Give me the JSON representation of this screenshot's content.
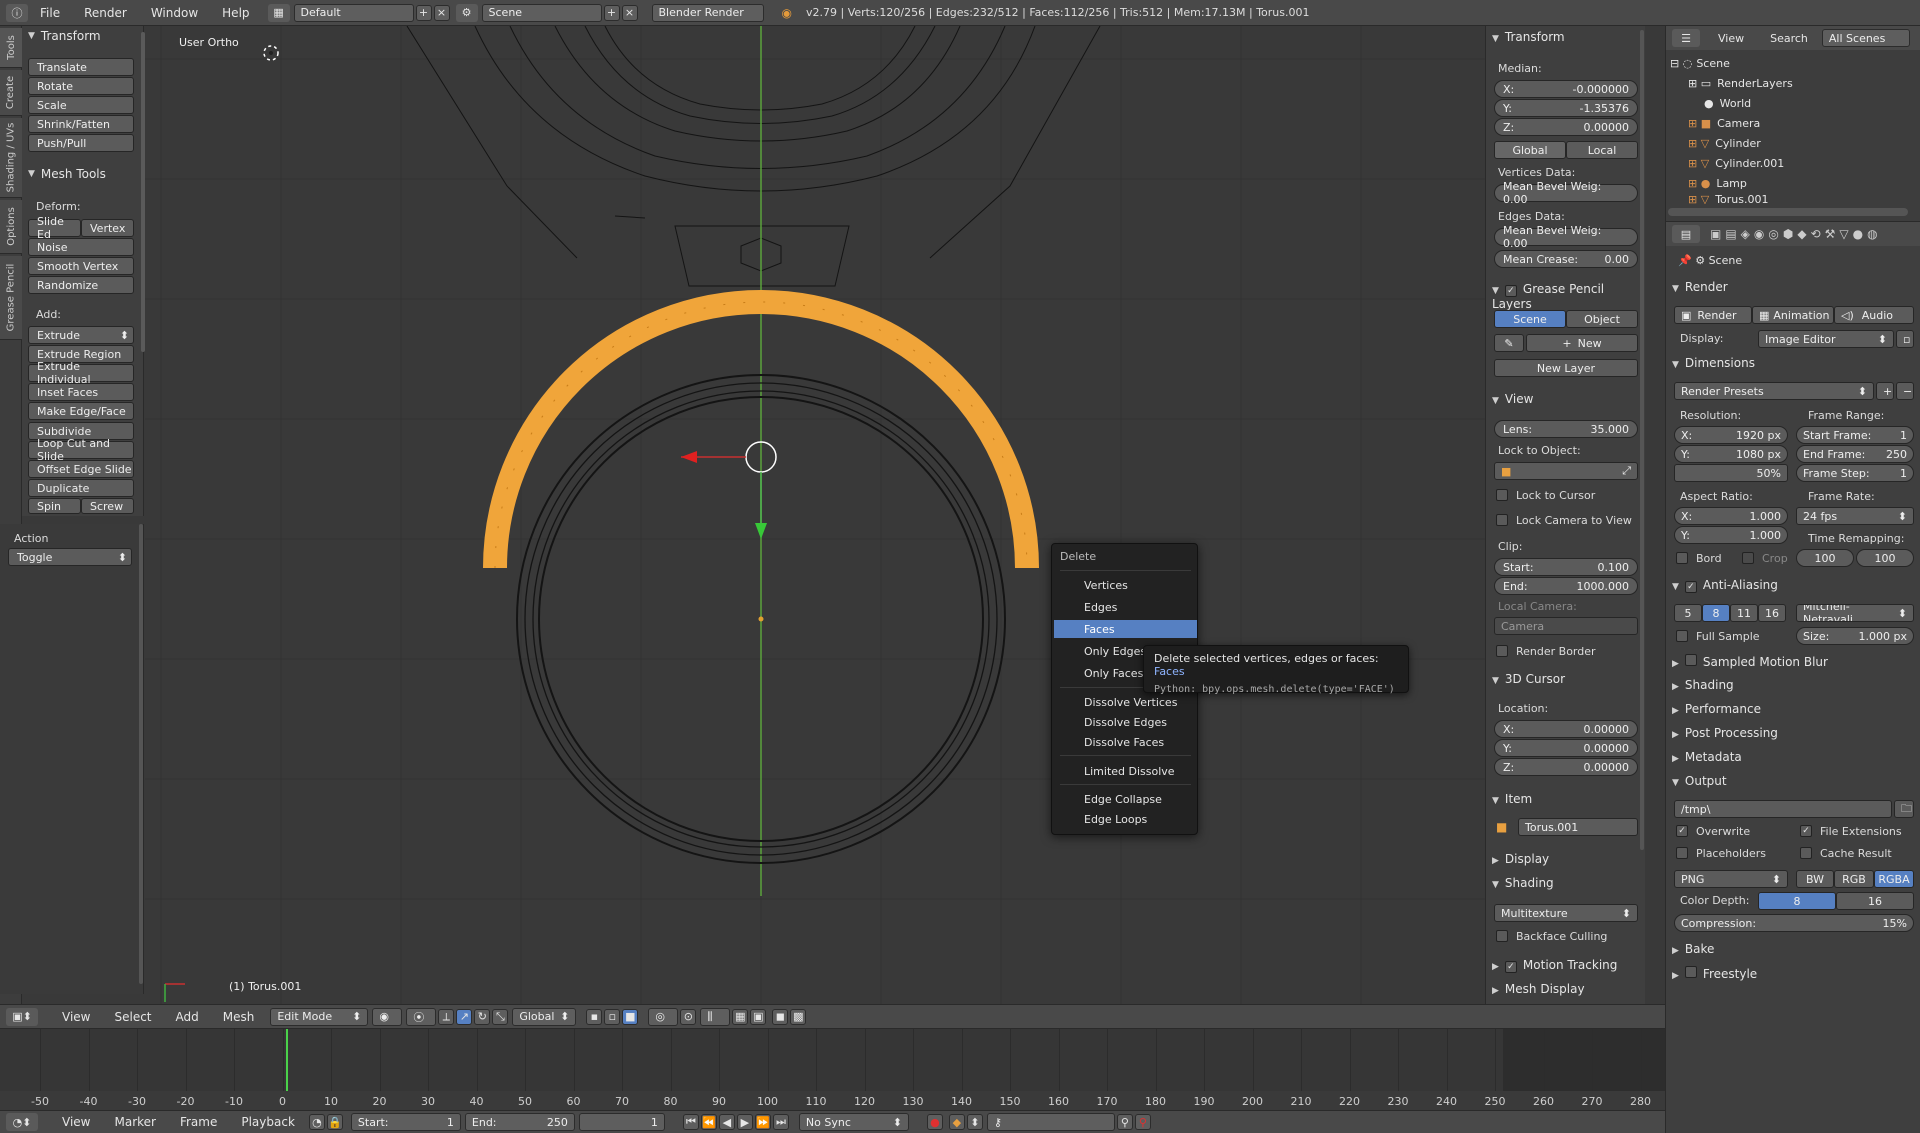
{
  "topbar": {
    "menus": [
      "File",
      "Render",
      "Window",
      "Help"
    ],
    "layout": "Default",
    "scene": "Scene",
    "engine": "Blender Render",
    "status": "v2.79 | Verts:120/256 | Edges:232/512 | Faces:112/256 | Tris:512 | Mem:17.13M | Torus.001"
  },
  "left_tabs": [
    "Tools",
    "Create",
    "Shading / UVs",
    "Options",
    "Grease Pencil"
  ],
  "tools": {
    "transform_title": "Transform",
    "transform": [
      "Translate",
      "Rotate",
      "Scale",
      "Shrink/Fatten",
      "Push/Pull"
    ],
    "mesh_tools_title": "Mesh Tools",
    "deform_label": "Deform:",
    "slide_edge": "Slide Ed",
    "vertex": "Vertex",
    "deform": [
      "Noise",
      "Smooth Vertex",
      "Randomize"
    ],
    "add_label": "Add:",
    "extrude": "Extrude",
    "add": [
      "Extrude Region",
      "Extrude Individual",
      "Inset Faces",
      "Make Edge/Face",
      "Subdivide",
      "Loop Cut and Slide",
      "Offset Edge Slide",
      "Duplicate"
    ],
    "spin": "Spin",
    "screw": "Screw"
  },
  "action": {
    "label": "Action",
    "value": "Toggle"
  },
  "viewport": {
    "view_label": "User Ortho",
    "object_label": "(1) Torus.001"
  },
  "delete_menu": {
    "title": "Delete",
    "items": [
      "Vertices",
      "Edges",
      "Faces",
      "Only Edges & Faces",
      "Only Faces",
      "Dissolve Vertices",
      "Dissolve Edges",
      "Dissolve Faces",
      "Limited Dissolve",
      "Edge Collapse",
      "Edge Loops"
    ],
    "selected": "Faces"
  },
  "tooltip": {
    "text": "Delete selected vertices, edges or faces:",
    "value": "Faces",
    "python": "Python: bpy.ops.mesh.delete(type='FACE')"
  },
  "npanel": {
    "transform_title": "Transform",
    "median": "Median:",
    "x": "X:",
    "x_val": "-0.000000",
    "y": "Y:",
    "y_val": "-1.35376",
    "z": "Z:",
    "z_val": "0.00000",
    "global": "Global",
    "local": "Local",
    "vertices_data": "Vertices Data:",
    "mean_bevel_v": "Mean Bevel Weig: 0.00",
    "edges_data": "Edges Data:",
    "mean_bevel_e": "Mean Bevel Weig: 0.00",
    "mean_crease": "Mean Crease:",
    "mean_crease_val": "0.00",
    "gp_title": "Grease Pencil Layers",
    "scene_btn": "Scene",
    "object_btn": "Object",
    "new": "New",
    "new_layer": "New Layer",
    "view_title": "View",
    "lens": "Lens:",
    "lens_val": "35.000",
    "lock_to_object": "Lock to Object:",
    "lock_to_cursor": "Lock to Cursor",
    "lock_camera": "Lock Camera to View",
    "clip": "Clip:",
    "clip_start": "Start:",
    "clip_start_val": "0.100",
    "clip_end": "End:",
    "clip_end_val": "1000.000",
    "local_camera": "Local Camera:",
    "camera": "Camera",
    "render_border": "Render Border",
    "cursor_title": "3D Cursor",
    "location": "Location:",
    "cx": "X:",
    "cx_val": "0.00000",
    "cy": "Y:",
    "cy_val": "0.00000",
    "cz": "Z:",
    "cz_val": "0.00000",
    "item_title": "Item",
    "item_name": "Torus.001",
    "display_title": "Display",
    "shading_title": "Shading",
    "multitexture": "Multitexture",
    "backface": "Backface Culling",
    "motion_tracking": "Motion Tracking",
    "mesh_display": "Mesh Display"
  },
  "outliner": {
    "view": "View",
    "search": "Search",
    "all_scenes": "All Scenes",
    "items": [
      "Scene",
      "RenderLayers",
      "World",
      "Camera",
      "Cylinder",
      "Cylinder.001",
      "Lamp",
      "Torus.001"
    ]
  },
  "props": {
    "scene": "Scene",
    "render_title": "Render",
    "render": "Render",
    "animation": "Animation",
    "audio": "Audio",
    "display": "Display:",
    "display_val": "Image Editor",
    "dimensions_title": "Dimensions",
    "render_presets": "Render Presets",
    "resolution": "Resolution:",
    "res_x": "X:",
    "res_x_val": "1920 px",
    "res_y": "Y:",
    "res_y_val": "1080 px",
    "res_pct": "50%",
    "frame_range": "Frame Range:",
    "start_frame": "Start Frame:",
    "start_frame_val": "1",
    "end_frame": "End Frame:",
    "end_frame_val": "250",
    "frame_step": "Frame Step:",
    "frame_step_val": "1",
    "aspect": "Aspect Ratio:",
    "ax": "X:",
    "ax_val": "1.000",
    "ay": "Y:",
    "ay_val": "1.000",
    "frame_rate": "Frame Rate:",
    "fps": "24 fps",
    "time_remap": "Time Remapping:",
    "remap_old": "100",
    "remap_new": "100",
    "bord": "Bord",
    "crop": "Crop",
    "aa_title": "Anti-Aliasing",
    "aa_values": [
      "5",
      "8",
      "11",
      "16"
    ],
    "aa_filter": "Mitchell-Netravali",
    "full_sample": "Full Sample",
    "size": "Size:",
    "size_val": "1.000 px",
    "sections": [
      "Sampled Motion Blur",
      "Shading",
      "Performance",
      "Post Processing",
      "Metadata"
    ],
    "output_title": "Output",
    "output_path": "/tmp\\",
    "overwrite": "Overwrite",
    "file_ext": "File Extensions",
    "placeholders": "Placeholders",
    "cache": "Cache Result",
    "format": "PNG",
    "bw": "BW",
    "rgb": "RGB",
    "rgba": "RGBA",
    "color_depth": "Color Depth:",
    "depth8": "8",
    "depth16": "16",
    "compression": "Compression:",
    "compression_val": "15%",
    "bake": "Bake",
    "freestyle": "Freestyle"
  },
  "viewhdr": {
    "menus": [
      "View",
      "Select",
      "Add",
      "Mesh"
    ],
    "mode": "Edit Mode",
    "orientation": "Global"
  },
  "timeline": {
    "ticks": [
      "-50",
      "-40",
      "-30",
      "-20",
      "-10",
      "0",
      "10",
      "20",
      "30",
      "40",
      "50",
      "60",
      "70",
      "80",
      "90",
      "100",
      "110",
      "120",
      "130",
      "140",
      "150",
      "160",
      "170",
      "180",
      "190",
      "200",
      "210",
      "220",
      "230",
      "240",
      "250",
      "260",
      "270",
      "280"
    ],
    "menus": [
      "View",
      "Marker",
      "Frame",
      "Playback"
    ],
    "start": "Start:",
    "start_val": "1",
    "end": "End:",
    "end_val": "250",
    "current": "1",
    "sync": "No Sync"
  }
}
